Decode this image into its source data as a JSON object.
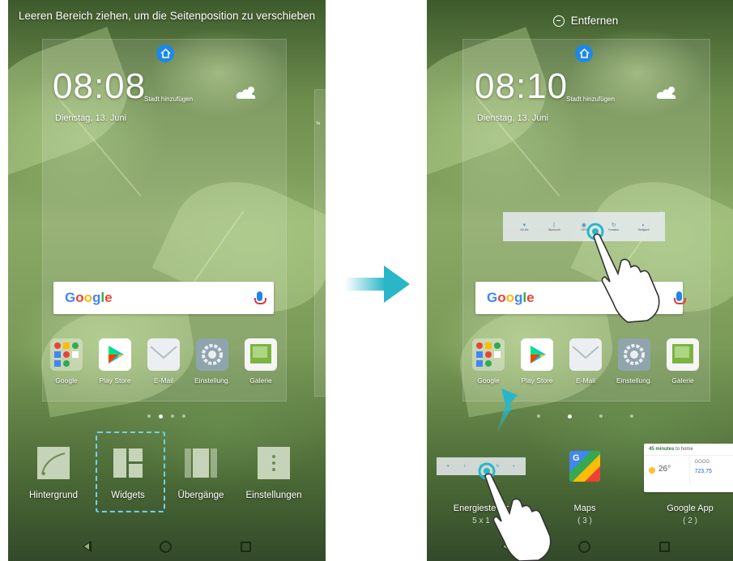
{
  "left_screen": {
    "hint": "Leeren Bereich ziehen, um die Seitenposition zu verschieben",
    "clock": {
      "time": "08:08",
      "city": "Stadt hinzufügen",
      "date": "Dienstag, 13. Juni"
    },
    "side_label": "Te",
    "search": {
      "logo": "Google"
    },
    "apps": [
      {
        "label": "Google",
        "icon": "google-folder-icon"
      },
      {
        "label": "Play Store",
        "icon": "play-store-icon"
      },
      {
        "label": "E-Mail",
        "icon": "email-icon"
      },
      {
        "label": "Einstellung.",
        "icon": "settings-icon"
      },
      {
        "label": "Galerie",
        "icon": "gallery-icon"
      }
    ],
    "edit_options": [
      {
        "label": "Hintergrund",
        "icon": "wallpaper-icon"
      },
      {
        "label": "Widgets",
        "icon": "widgets-icon"
      },
      {
        "label": "Übergänge",
        "icon": "transitions-icon"
      },
      {
        "label": "Einstellungen",
        "icon": "more-settings-icon"
      }
    ],
    "highlight_color": "#6fd4e6"
  },
  "right_screen": {
    "remove_label": "Entfernen",
    "clock": {
      "time": "08:10",
      "city": "Stadt hinzufügen",
      "date": "Dienstag, 13. Juni"
    },
    "search": {
      "logo": "Google"
    },
    "apps": [
      {
        "label": "Google",
        "icon": "google-folder-icon"
      },
      {
        "label": "Play Store",
        "icon": "play-store-icon"
      },
      {
        "label": "E-Mail",
        "icon": "email-icon"
      },
      {
        "label": "Einstellung.",
        "icon": "settings-icon"
      },
      {
        "label": "Galerie",
        "icon": "gallery-icon"
      }
    ],
    "widget_strip_labels": [
      "WLAN",
      "Bluetooth",
      "GPS",
      "Rotation",
      "Helligkeit"
    ],
    "widgets": [
      {
        "label": "Energiesteuer",
        "sub": "5 x 1"
      },
      {
        "label": "Maps",
        "sub": "( 3 )"
      },
      {
        "label": "Google App",
        "sub": "( 2 )"
      }
    ],
    "google_card": {
      "headline": "45 minutes",
      "headline_rest": "to home",
      "temp": "26°",
      "stock": "723.75",
      "stock_sym": "GOOG"
    }
  },
  "colors": {
    "accent": "#29b6c8",
    "home_blue": "#1e88e5",
    "mic_red": "#e53935"
  }
}
